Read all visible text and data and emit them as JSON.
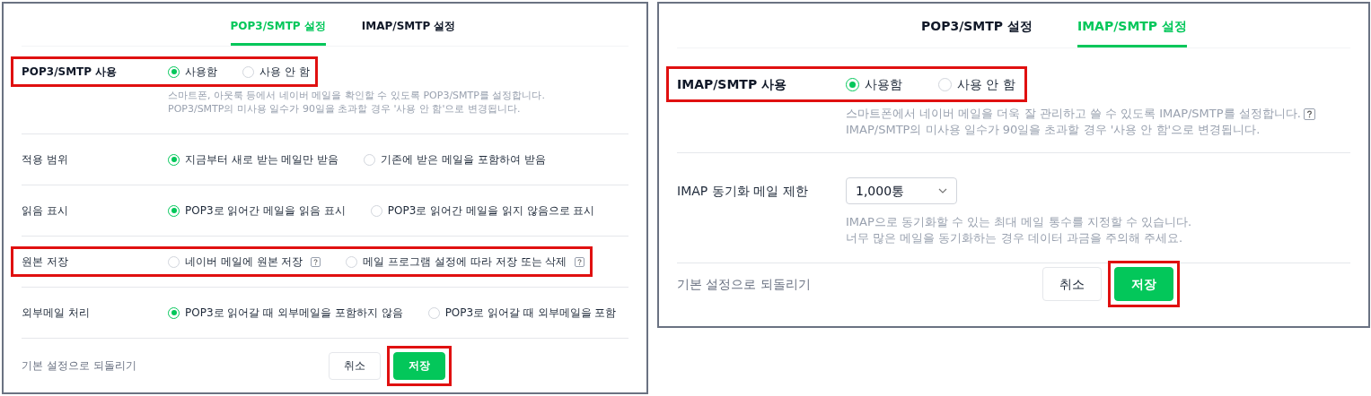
{
  "panels": [
    {
      "tabs": [
        {
          "label": "POP3/SMTP 설정",
          "selected": true
        },
        {
          "label": "IMAP/SMTP 설정",
          "selected": false
        }
      ],
      "rows": [
        {
          "kind": "radio",
          "label": "POP3/SMTP 사용",
          "strong": true,
          "highlighted": true,
          "options": [
            {
              "label": "사용함",
              "selected": true,
              "help": false
            },
            {
              "label": "사용 안 함",
              "selected": false,
              "help": false
            }
          ],
          "description": [
            "스마트폰, 아웃룩 등에서 네이버 메일을 확인할 수 있도록 POP3/SMTP를 설정합니다.",
            "POP3/SMTP의 미사용 일수가 90일을 초과할 경우 '사용 안 함'으로 변경됩니다."
          ]
        },
        {
          "kind": "radio",
          "label": "적용 범위",
          "strong": false,
          "highlighted": false,
          "options": [
            {
              "label": "지금부터 새로 받는 메일만 받음",
              "selected": true,
              "help": false
            },
            {
              "label": "기존에 받은 메일을 포함하여 받음",
              "selected": false,
              "help": false
            }
          ]
        },
        {
          "kind": "radio",
          "label": "읽음 표시",
          "strong": false,
          "highlighted": false,
          "options": [
            {
              "label": "POP3로 읽어간 메일을 읽음 표시",
              "selected": true,
              "help": false
            },
            {
              "label": "POP3로 읽어간 메일을 읽지 않음으로 표시",
              "selected": false,
              "help": false
            }
          ]
        },
        {
          "kind": "radio",
          "label": "원본 저장",
          "strong": false,
          "highlighted": true,
          "options": [
            {
              "label": "네이버 메일에 원본 저장",
              "selected": false,
              "help": true
            },
            {
              "label": "메일 프로그램 설정에 따라 저장 또는 삭제",
              "selected": false,
              "help": true
            }
          ]
        },
        {
          "kind": "radio",
          "label": "외부메일 처리",
          "strong": false,
          "highlighted": false,
          "options": [
            {
              "label": "POP3로 읽어갈 때 외부메일을 포함하지 않음",
              "selected": true,
              "help": false
            },
            {
              "label": "POP3로 읽어갈 때 외부메일을 포함",
              "selected": false,
              "help": false
            }
          ]
        }
      ],
      "footer": {
        "reset_link": "기본 설정으로 되돌리기",
        "buttons": [
          {
            "label": "취소",
            "kind": "secondary",
            "highlighted": false
          },
          {
            "label": "저장",
            "kind": "primary",
            "highlighted": true
          }
        ]
      }
    },
    {
      "tabs": [
        {
          "label": "POP3/SMTP 설정",
          "selected": false
        },
        {
          "label": "IMAP/SMTP 설정",
          "selected": true
        }
      ],
      "rows": [
        {
          "kind": "radio",
          "label": "IMAP/SMTP 사용",
          "strong": true,
          "highlighted": true,
          "options": [
            {
              "label": "사용함",
              "selected": true,
              "help": false
            },
            {
              "label": "사용 안 함",
              "selected": false,
              "help": false
            }
          ],
          "description": [
            "스마트폰에서 네이버 메일을 더욱 잘 관리하고 쓸 수 있도록 IMAP/SMTP를 설정합니다.",
            "IMAP/SMTP의 미사용 일수가 90일을 초과할 경우 '사용 안 함'으로 변경됩니다."
          ],
          "description_help": true
        },
        {
          "kind": "select",
          "label": "IMAP 동기화 메일 제한",
          "strong": false,
          "highlighted": false,
          "value": "1,000통",
          "description": [
            "IMAP으로 동기화할 수 있는 최대 메일 통수를 지정할 수 있습니다.",
            "너무 많은 메일을 동기화하는 경우 데이터 과금을 주의해 주세요."
          ]
        }
      ],
      "footer": {
        "reset_link": "기본 설정으로 되돌리기",
        "buttons": [
          {
            "label": "취소",
            "kind": "secondary",
            "highlighted": false
          },
          {
            "label": "저장",
            "kind": "primary",
            "highlighted": true
          }
        ]
      }
    }
  ]
}
